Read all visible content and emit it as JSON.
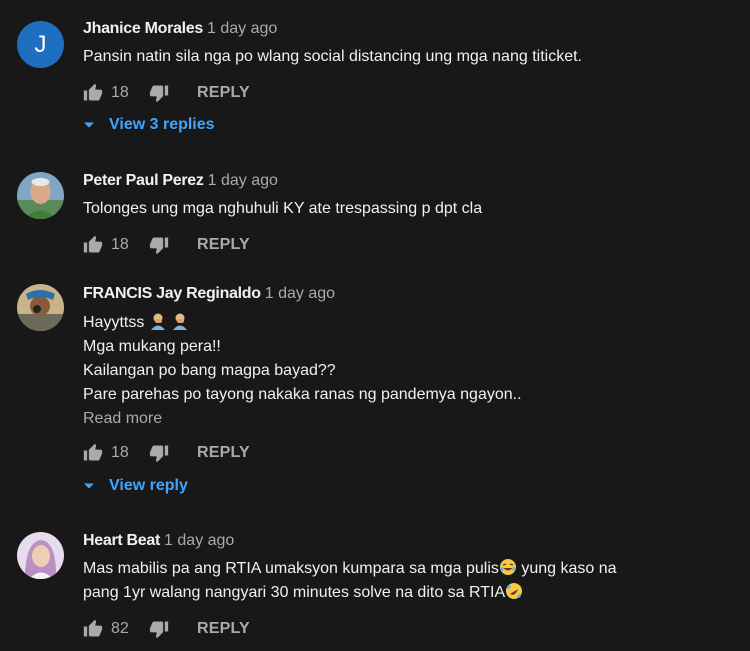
{
  "comments": [
    {
      "author": "Jhanice Morales",
      "time": "1 day ago",
      "avatar_letter": "J",
      "lines": [
        "Pansin natin sila nga po wlang social distancing ung mga nang titicket."
      ],
      "likes": "18",
      "reply_label": "REPLY",
      "view_replies": "View 3 replies"
    },
    {
      "author": "Peter Paul Perez",
      "time": "1 day ago",
      "lines": [
        "Tolonges ung mga nghuhuli KY ate trespassing p dpt cla"
      ],
      "likes": "18",
      "reply_label": "REPLY"
    },
    {
      "author": "FRANCIS Jay Reginaldo",
      "time": "1 day ago",
      "lines": [
        "Hayyttss",
        "Mga mukang pera!!",
        "Kailangan po bang magpa bayad??",
        "Pare parehas po tayong nakaka ranas ng pandemya ngayon.."
      ],
      "read_more": "Read more",
      "likes": "18",
      "reply_label": "REPLY",
      "view_replies": "View reply"
    },
    {
      "author": "Heart Beat",
      "time": "1 day ago",
      "lines": [
        "Mas mabilis pa ang RTIA umaksyon kumpara sa mga pulis",
        "yung kaso na",
        "pang 1yr walang nangyari 30 minutes solve na dito sa RTIA"
      ],
      "likes": "82",
      "reply_label": "REPLY"
    }
  ],
  "colors": {
    "background": "#181818",
    "link": "#3ea6ff",
    "secondary_text": "#aaaaaa",
    "avatar_j": "#1e6fbf"
  }
}
